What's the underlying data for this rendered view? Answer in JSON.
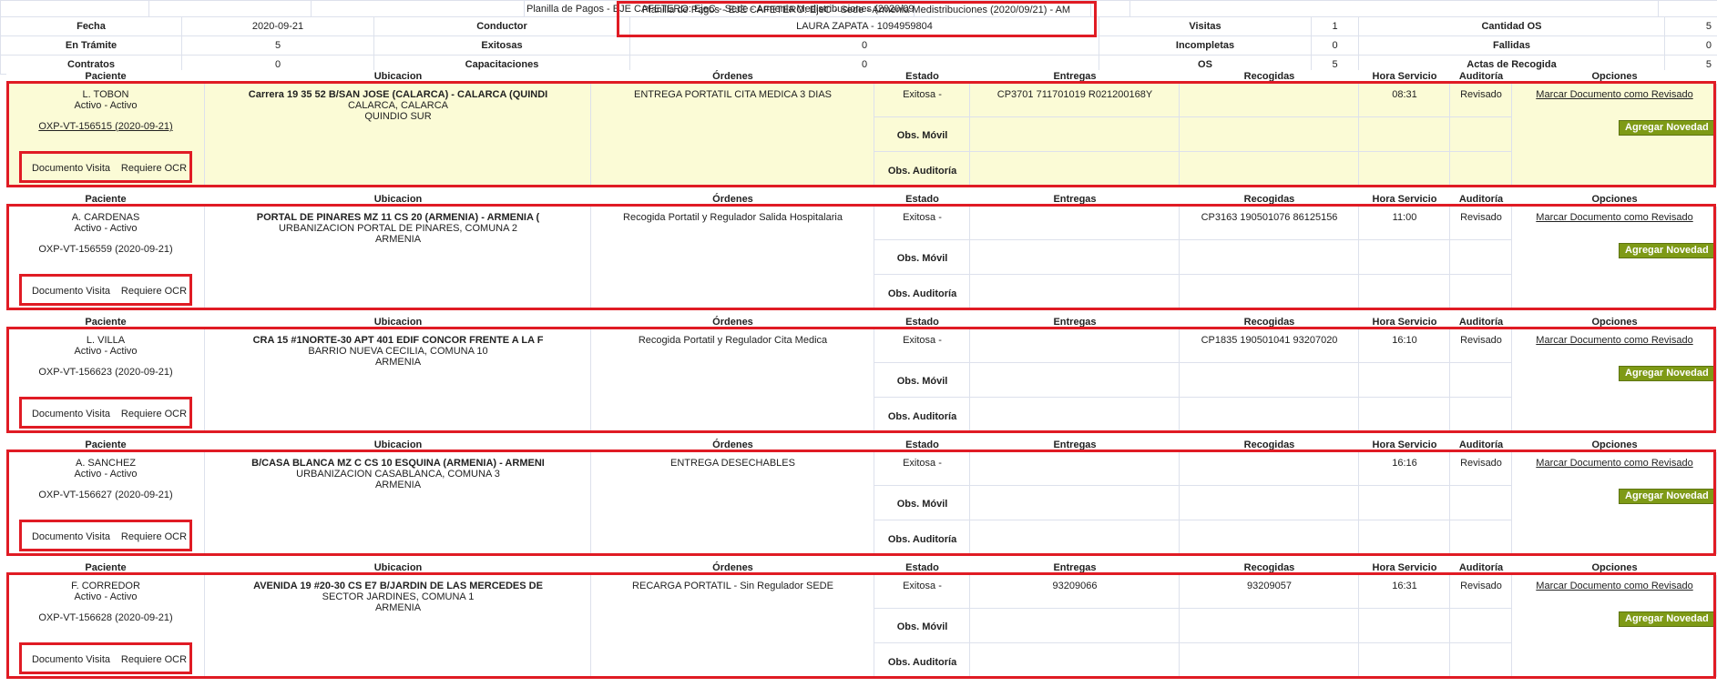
{
  "title": "Planilla de Pagos - EJE CAFETERO: EjeC - Sede - Armenia Medistribuciones (2020/09/21) - AM",
  "summary": {
    "fecha_label": "Fecha",
    "fecha": "2020-09-21",
    "conductor_label": "Conductor",
    "conductor": "LAURA ZAPATA - 1094959804",
    "visitas_label": "Visitas",
    "visitas": "1",
    "cantidad_os_label": "Cantidad OS",
    "cantidad_os": "5",
    "en_tramite_label": "En Trámite",
    "en_tramite": "5",
    "exitosas_label": "Exitosas",
    "exitosas": "0",
    "incompletas_label": "Incompletas",
    "incompletas": "0",
    "fallidas_label": "Fallidas",
    "fallidas": "0",
    "contratos_label": "Contratos",
    "contratos": "0",
    "capacitaciones_label": "Capacitaciones",
    "capacitaciones": "0",
    "os_label": "OS",
    "os": "5",
    "actas_label": "Actas de Recogida",
    "actas": "5"
  },
  "columns": {
    "paciente": "Paciente",
    "ubicacion": "Ubicacion",
    "ordenes": "Órdenes",
    "estado": "Estado",
    "entregas": "Entregas",
    "recogidas": "Recogidas",
    "hora": "Hora Servicio",
    "auditoria": "Auditoría",
    "opciones": "Opciones"
  },
  "labels": {
    "obs_movil": "Obs. Móvil",
    "obs_auditoria": "Obs. Auditoría",
    "documento_visita": "Documento Visita",
    "requiere_ocr": "Requiere OCR",
    "marcar": "Marcar Documento como Revisado",
    "agregar": "Agregar Novedad"
  },
  "records": [
    {
      "name": "L. TOBON",
      "status": "Activo - Activo",
      "doc": "OXP-VT-156515 (2020-09-21)",
      "addr1": "Carrera 19 35 52 B/SAN JOSE (CALARCA) - CALARCA (QUINDI",
      "addr2": "CALARCA, CALARCA",
      "addr3": "QUINDIO SUR",
      "orden": "ENTREGA PORTATIL CITA MEDICA 3 DIAS",
      "estado": "Exitosa -",
      "entregas": "CP3701 711701019 R021200168Y",
      "recogidas": "",
      "hora": "08:31",
      "auditoria": "Revisado"
    },
    {
      "name": "A. CARDENAS",
      "status": "Activo - Activo",
      "doc": "OXP-VT-156559 (2020-09-21)",
      "addr1": "PORTAL DE PINARES MZ 11 CS 20 (ARMENIA) - ARMENIA (",
      "addr2": "URBANIZACION PORTAL DE PINARES, COMUNA 2",
      "addr3": "ARMENIA",
      "orden": "Recogida Portatil y Regulador Salida Hospitalaria",
      "estado": "Exitosa -",
      "entregas": "",
      "recogidas": "CP3163 190501076 86125156",
      "hora": "11:00",
      "auditoria": "Revisado"
    },
    {
      "name": "L. VILLA",
      "status": "Activo - Activo",
      "doc": "OXP-VT-156623 (2020-09-21)",
      "addr1": "CRA 15 #1NORTE-30 APT 401 EDIF CONCOR FRENTE A LA F",
      "addr2": "BARRIO NUEVA CECILIA, COMUNA 10",
      "addr3": "ARMENIA",
      "orden": "Recogida Portatil y Regulador Cita Medica",
      "estado": "Exitosa -",
      "entregas": "",
      "recogidas": "CP1835 190501041 93207020",
      "hora": "16:10",
      "auditoria": "Revisado"
    },
    {
      "name": "A. SANCHEZ",
      "status": "Activo - Activo",
      "doc": "OXP-VT-156627 (2020-09-21)",
      "addr1": "B/CASA BLANCA MZ C CS 10 ESQUINA (ARMENIA) - ARMENI",
      "addr2": "URBANIZACION CASABLANCA, COMUNA 3",
      "addr3": "ARMENIA",
      "orden": "ENTREGA DESECHABLES",
      "estado": "Exitosa -",
      "entregas": "",
      "recogidas": "",
      "hora": "16:16",
      "auditoria": "Revisado"
    },
    {
      "name": "F. CORREDOR",
      "status": "Activo - Activo",
      "doc": "OXP-VT-156628 (2020-09-21)",
      "addr1": "AVENIDA 19 #20-30 CS E7 B/JARDIN DE LAS MERCEDES DE",
      "addr2": "SECTOR JARDINES, COMUNA 1",
      "addr3": "ARMENIA",
      "orden": "RECARGA PORTATIL - Sin Regulador SEDE",
      "estado": "Exitosa -",
      "entregas": "93209066",
      "recogidas": "93209057",
      "hora": "16:31",
      "auditoria": "Revisado"
    }
  ],
  "colors": {
    "highlight_row": "#fbfbd6",
    "button": "#7e9a16",
    "annotation_box": "#e01b24",
    "grid": "#dde1ec"
  }
}
